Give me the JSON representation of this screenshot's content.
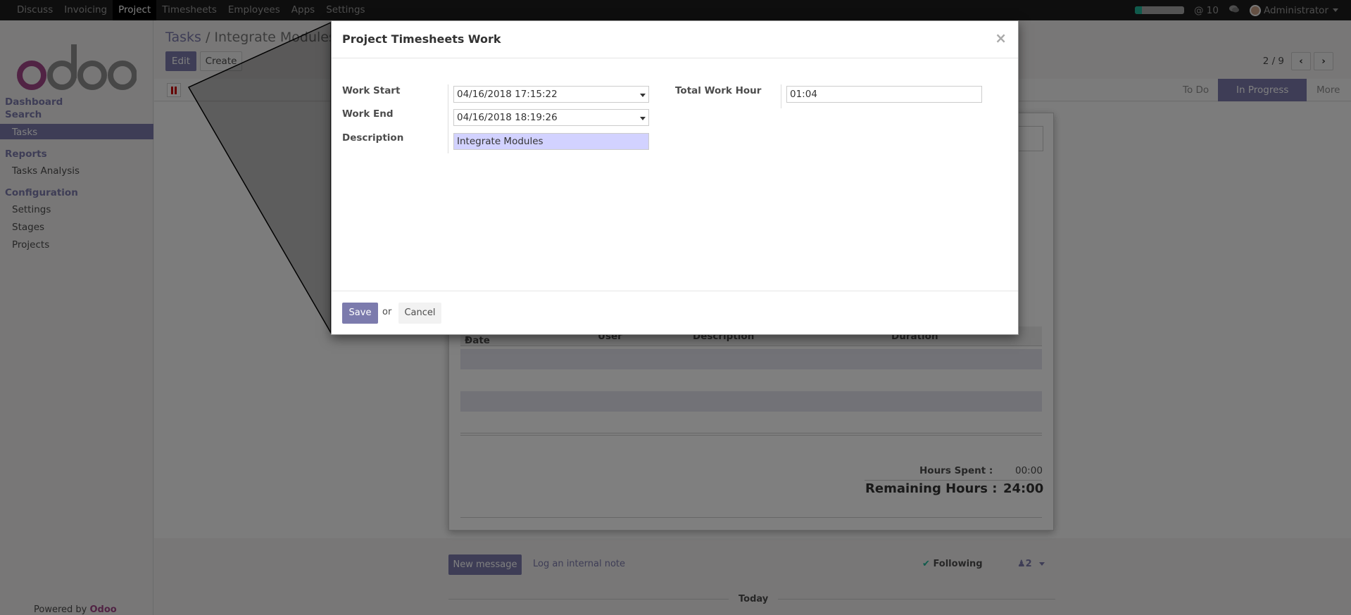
{
  "topbar": {
    "menu": [
      "Discuss",
      "Invoicing",
      "Project",
      "Timesheets",
      "Employees",
      "Apps",
      "Settings"
    ],
    "progress": 0.15,
    "mentions": "@ 10",
    "user": "Administrator"
  },
  "sidebar": {
    "dashboard": "Dashboard",
    "search": "Search",
    "tasks": "Tasks",
    "reports": "Reports",
    "tasks_analysis": "Tasks Analysis",
    "configuration": "Configuration",
    "settings": "Settings",
    "stages": "Stages",
    "projects": "Projects",
    "powered_by": "Powered by",
    "powered_brand": "Odoo"
  },
  "control": {
    "breadcrumb_root": "Tasks",
    "breadcrumb_sep": "/",
    "breadcrumb_current": "Integrate Modules",
    "edit": "Edit",
    "create": "Create",
    "pager": "2 / 9"
  },
  "stages": [
    "To Do",
    "In Progress",
    "More"
  ],
  "timesheet_table": {
    "columns": [
      "Date",
      "User",
      "Description",
      "Duration"
    ],
    "hours_spent_label": "Hours Spent :",
    "hours_spent": "00:00",
    "remaining_label": "Remaining Hours :",
    "remaining": "24:00"
  },
  "chatter": {
    "new_message": "New message",
    "log_note": "Log an internal note",
    "following": "Following",
    "followers": "2",
    "today": "Today"
  },
  "modal": {
    "title": "Project Timesheets Work",
    "work_start_label": "Work Start",
    "work_start": "04/16/2018 17:15:22",
    "work_end_label": "Work End",
    "work_end": "04/16/2018 18:19:26",
    "description_label": "Description",
    "description": "Integrate Modules",
    "total_label": "Total Work Hour",
    "total": "01:04",
    "save": "Save",
    "or": "or",
    "cancel": "Cancel"
  }
}
